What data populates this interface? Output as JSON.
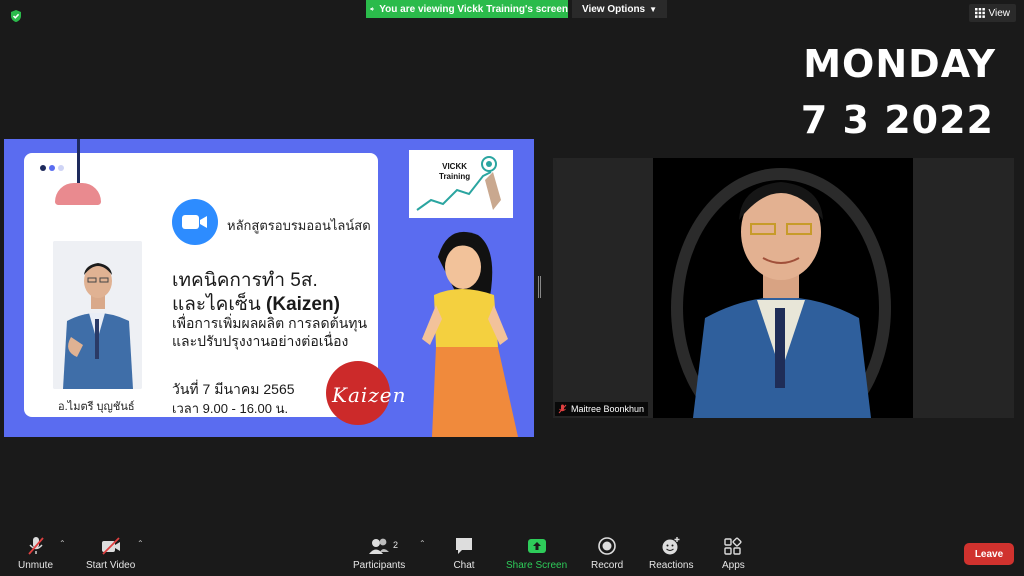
{
  "topbar": {
    "share_banner": "You are viewing Vickk Training's screen",
    "view_options": "View Options",
    "view_button": "View"
  },
  "date_overlay": {
    "day": "MONDAY",
    "date": "7 3 2022"
  },
  "slide": {
    "teacher_name": "อ.ไมตรี  บุญชันธ์",
    "course_type": "หลักสูตรอบรมออนไลน์สด",
    "title_line1": "เทคนิคการทำ 5ส.",
    "title_line2_prefix": "และไคเซ็น ",
    "title_line2_bold": "(Kaizen)",
    "subtitle_line1": "เพื่อการเพิ่มผลผลิต การลดต้นทุน",
    "subtitle_line2": "และปรับปรุงงานอย่างต่อเนื่อง",
    "date_text": "วันที่ 7 มีนาคม 2565",
    "time_text": "เวลา  9.00 - 16.00 น.",
    "kaizen_logo_text": "Kaizen",
    "brand_line1": "VICKK",
    "brand_line2": "Training"
  },
  "participant": {
    "name": "Maitree Boonkhun"
  },
  "toolbar": {
    "unmute": "Unmute",
    "start_video": "Start Video",
    "participants": "Participants",
    "participants_count": "2",
    "chat": "Chat",
    "share_screen": "Share Screen",
    "record": "Record",
    "reactions": "Reactions",
    "apps": "Apps",
    "leave": "Leave"
  },
  "colors": {
    "share_green": "#2bbb4b",
    "slide_bg": "#5a6cf0",
    "leave_red": "#d0322e",
    "zoom_blue": "#2d8cff"
  }
}
